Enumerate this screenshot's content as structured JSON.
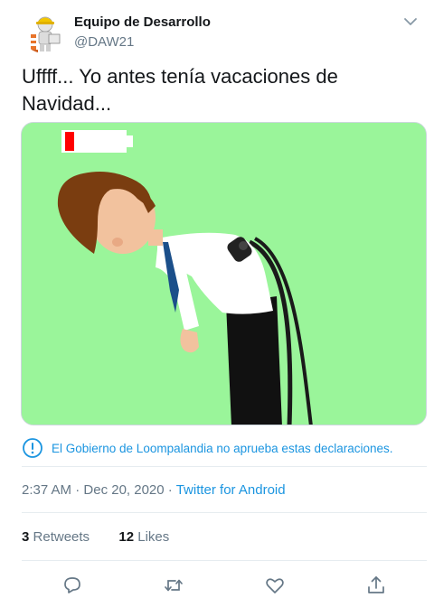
{
  "author": {
    "display_name": "Equipo de Desarrollo",
    "handle": "@DAW21",
    "avatar_icon": "construction-worker-avatar"
  },
  "tweet": {
    "text": "Uffff... Yo antes tenía vacaciones de Navidad...",
    "image_description_icon": "tired-man-with-plug-battery-low"
  },
  "notice": {
    "text": "El Gobierno de Loompalandia no aprueba estas declaraciones.",
    "icon": "exclamation-circle-icon"
  },
  "meta": {
    "time": "2:37 AM",
    "separator": "·",
    "date": "Dec 20, 2020",
    "source": "Twitter for Android"
  },
  "stats": {
    "retweets_count": "3",
    "retweets_label": "Retweets",
    "likes_count": "12",
    "likes_label": "Likes"
  },
  "actions": [
    "reply-icon",
    "retweet-icon",
    "like-icon",
    "share-icon"
  ],
  "colors": {
    "accent": "#1b95e0",
    "text": "#14171a",
    "muted": "#657786",
    "image_bg": "#9af59a",
    "battery_low": "#ff0000"
  }
}
